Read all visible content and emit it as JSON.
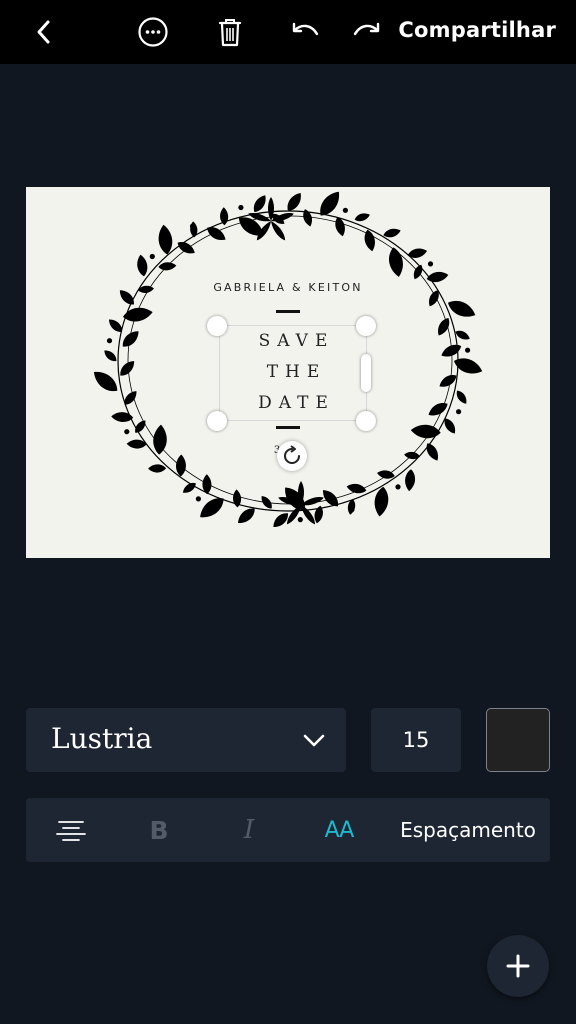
{
  "toolbar": {
    "back_icon": "chevron-left-icon",
    "more_icon": "more-horizontal-icon",
    "delete_icon": "trash-icon",
    "undo_icon": "undo-icon",
    "redo_icon": "redo-icon",
    "share_label": "Compartilhar"
  },
  "design": {
    "background": "#f3f3ee",
    "names": "GABRIELA & KEITON",
    "save_lines": [
      "SAVE",
      "THE",
      "DATE"
    ],
    "date_visible": "30 8",
    "wreath_color": "#000000",
    "rotate_icon": "rotate-icon"
  },
  "text_controls": {
    "font_name": "Lustria",
    "font_size": "15",
    "text_color": "#222222",
    "chevron_icon": "chevron-down-icon"
  },
  "format_bar": {
    "align_icon": "align-center-icon",
    "bold_label": "B",
    "italic_label": "I",
    "case_label": "AA",
    "case_active_color": "#1fb8cc",
    "spacing_label": "Espaçamento"
  },
  "fab": {
    "icon": "plus-icon"
  }
}
